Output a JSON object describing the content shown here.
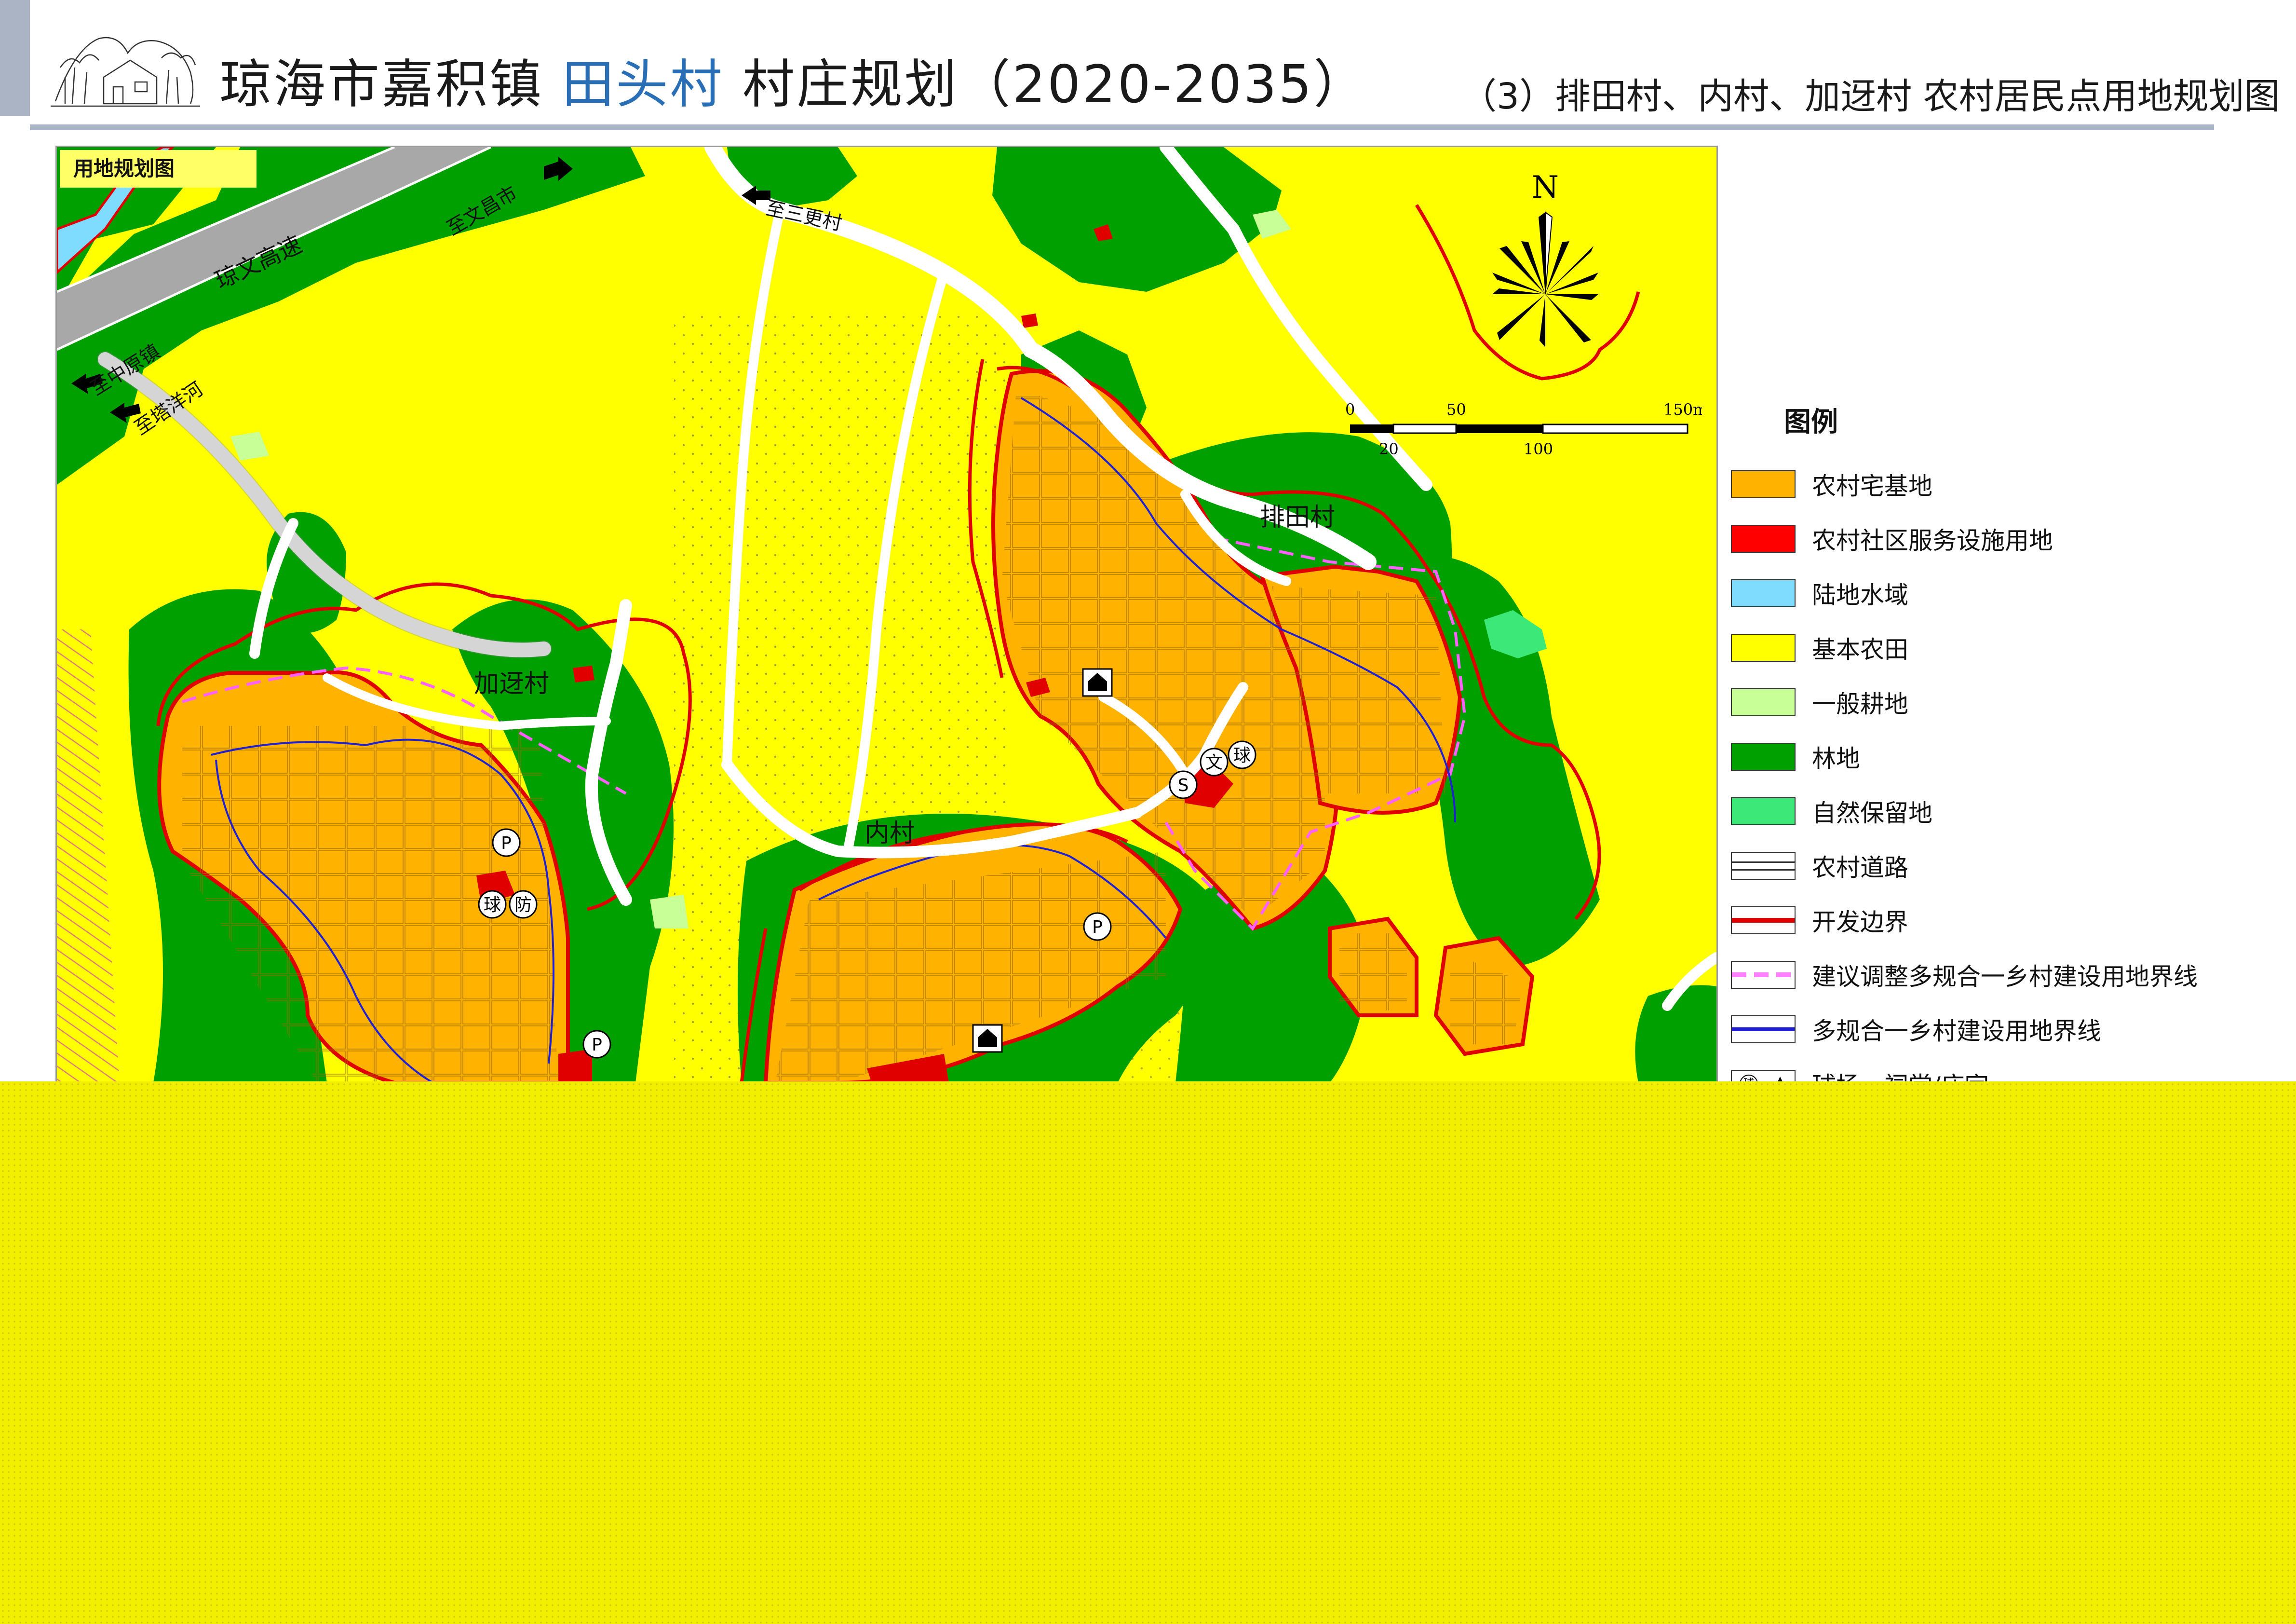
{
  "header": {
    "title_prefix": "琼海市嘉积镇",
    "title_highlight": "田头村",
    "title_suffix": "村庄规划（2020-2035）",
    "subtitle": "（3）排田村、内村、加迓村 农村居民点用地规划图"
  },
  "map": {
    "tag": "用地规划图",
    "village_labels": [
      "加迓村",
      "内村",
      "排田村"
    ],
    "road_labels": {
      "highway": "琼文高速",
      "to_wenchang": "至文昌市",
      "to_sangeng": "至三更村",
      "to_zhongyuan": "至中原镇",
      "to_tayanghe": "至塔洋河"
    },
    "north_letter": "N",
    "scale": {
      "top_labels": [
        "0",
        "50",
        "150m"
      ],
      "bottom_labels": [
        "20",
        "100"
      ]
    },
    "facility_symbols": {
      "parking": "P",
      "ball": "球",
      "fire": "防",
      "culture": "文",
      "s": "S"
    }
  },
  "legend": {
    "title": "图例",
    "items": [
      {
        "label": "农村宅基地",
        "color": "#ffb300",
        "style": "fill"
      },
      {
        "label": "农村社区服务设施用地",
        "color": "#ff0000",
        "style": "fill"
      },
      {
        "label": "陆地水域",
        "color": "#80dcff",
        "style": "fill"
      },
      {
        "label": "基本农田",
        "color": "#ffff00",
        "style": "fill"
      },
      {
        "label": "一般耕地",
        "color": "#c8ff96",
        "style": "fill"
      },
      {
        "label": "林地",
        "color": "#00a000",
        "style": "fill"
      },
      {
        "label": "自然保留地",
        "color": "#3ce878",
        "style": "fill"
      },
      {
        "label": "农村道路",
        "color": "#ffffff",
        "style": "road"
      },
      {
        "label": "开发边界",
        "color": "#e00000",
        "style": "line"
      },
      {
        "label": "建议调整多规合一乡村建设用地界线",
        "color": "#ff80ff",
        "style": "dash"
      },
      {
        "label": "多规合一乡村建设用地界线",
        "color": "#2020d0",
        "style": "line"
      },
      {
        "label": "球场、祠堂/庙宇",
        "color": "#000000",
        "style": "symbol"
      }
    ]
  }
}
